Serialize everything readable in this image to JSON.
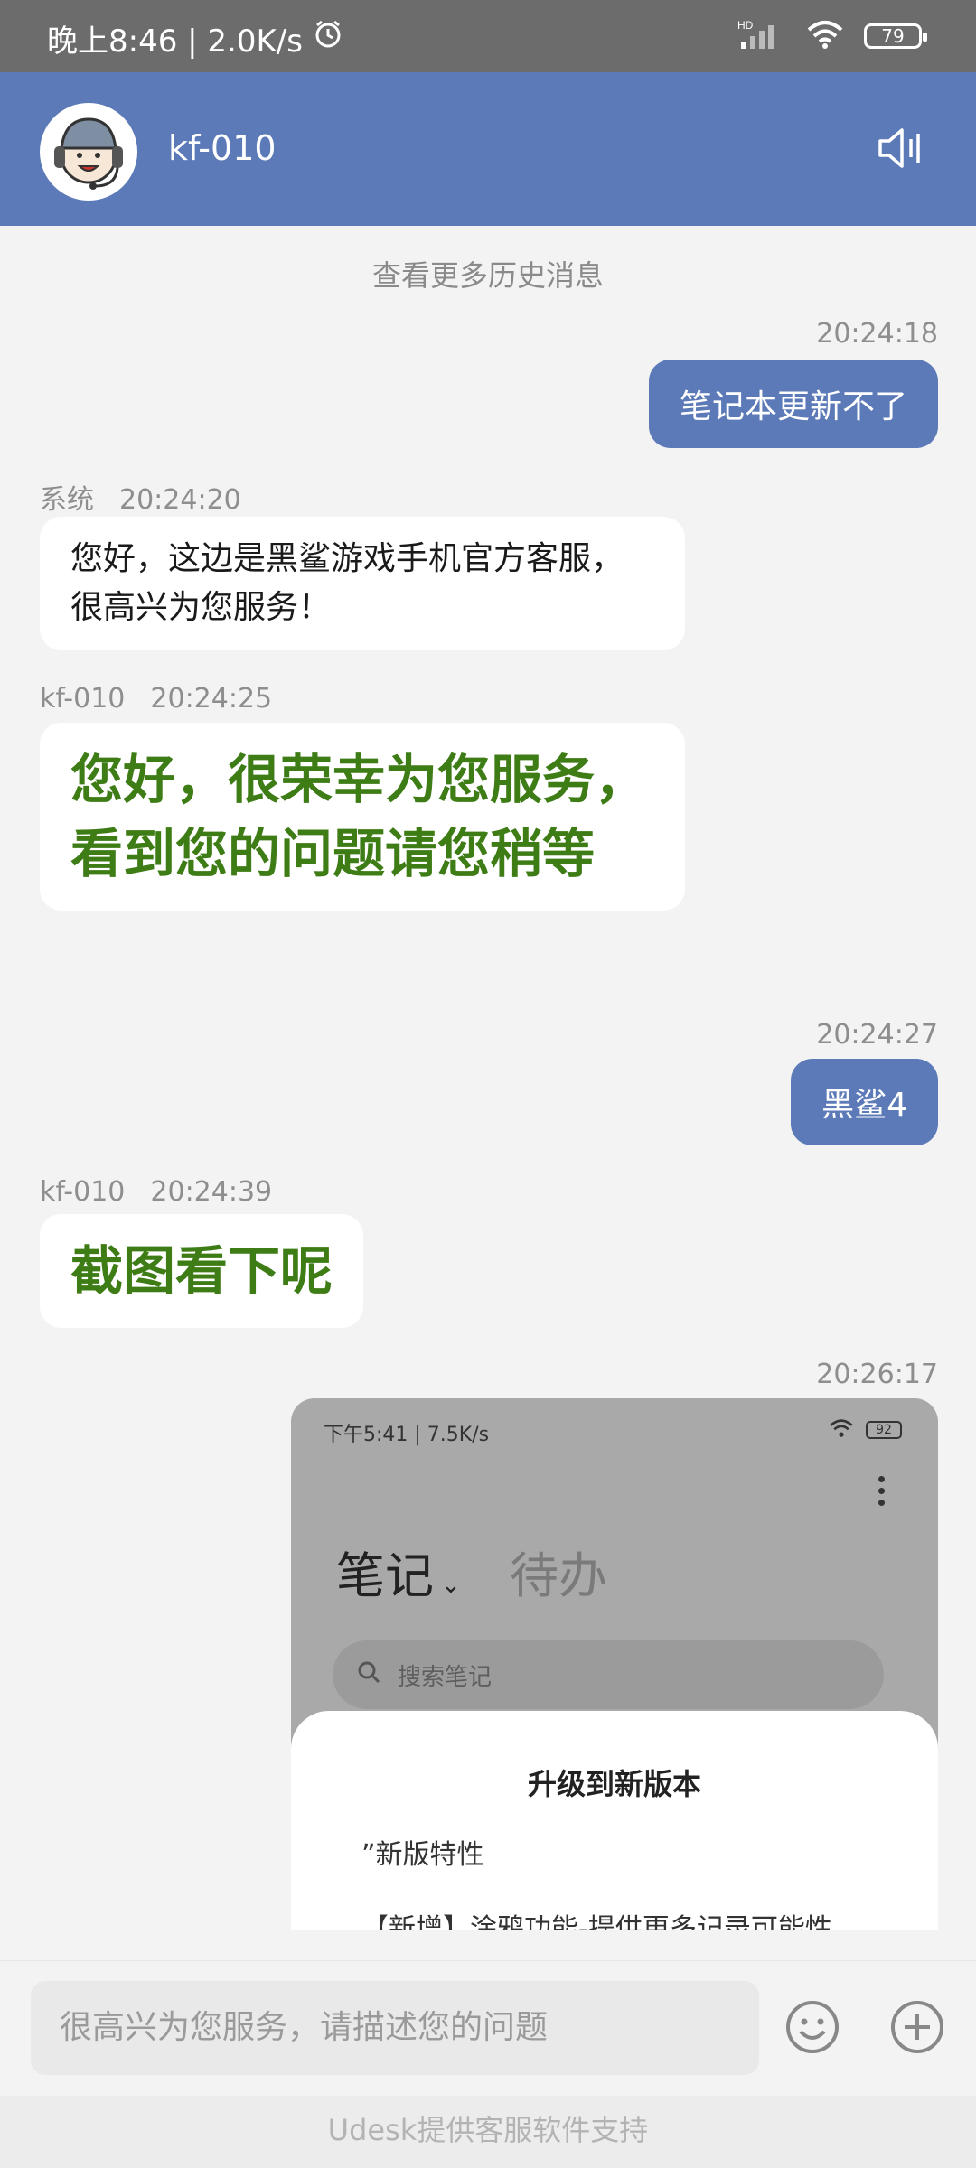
{
  "status_bar": {
    "left_text": "晚上8:46 | 2.0K/s",
    "battery": "79",
    "signal_label": "HD"
  },
  "header": {
    "agent_name": "kf-010"
  },
  "chat": {
    "history_link": "查看更多历史消息",
    "messages": [
      {
        "from": "me",
        "time": "20:24:18",
        "text": "笔记本更新不了"
      },
      {
        "from": "系统",
        "time": "20:24:20",
        "text": "您好，这边是黑鲨游戏手机官方客服，很高兴为您服务！"
      },
      {
        "from": "kf-010",
        "time": "20:24:25",
        "text": "您好，很荣幸为您服务，看到您的问题请您稍等"
      },
      {
        "from": "me",
        "time": "20:24:27",
        "text": "黑鲨4"
      },
      {
        "from": "kf-010",
        "time": "20:24:39",
        "text": "截图看下呢"
      },
      {
        "from": "me",
        "time": "20:26:17",
        "text": ""
      }
    ],
    "screenshot": {
      "status_left": "下午5:41 | 7.5K/s",
      "battery": "92",
      "tab_notes": "笔记",
      "tab_todo": "待办",
      "search_placeholder": "搜索笔记",
      "dialog_title": "升级到新版本",
      "dialog_line1": "”新版特性",
      "dialog_line2": "【新增】涂鸦功能-提供更多记录可能性"
    }
  },
  "input": {
    "placeholder": "很高兴为您服务，请描述您的问题"
  },
  "footer": {
    "text": "Udesk提供客服软件支持"
  },
  "colors": {
    "header": "#5c7ab8",
    "outgoing_bubble": "#5c7ab8",
    "agent_bold_text": "#3e7c16",
    "status_bar": "#6c6c6c"
  }
}
